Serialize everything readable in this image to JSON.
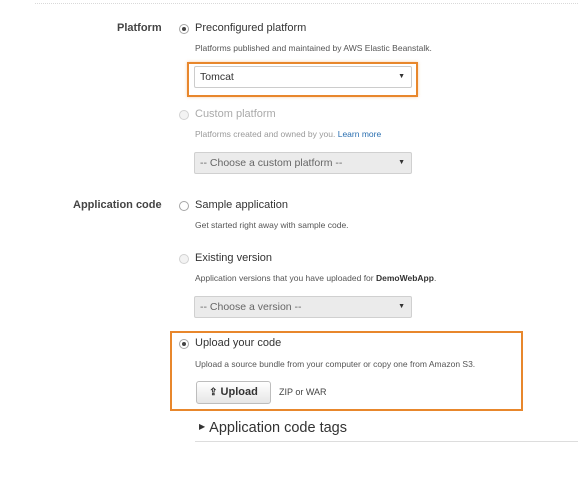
{
  "platform": {
    "label": "Platform",
    "preconfigured": {
      "title": "Preconfigured platform",
      "description": "Platforms published and maintained by AWS Elastic Beanstalk.",
      "selected": true,
      "select_value": "Tomcat"
    },
    "custom": {
      "title": "Custom platform",
      "description": "Platforms created and owned by you.",
      "link": "Learn more",
      "select_value": "-- Choose a custom platform --",
      "enabled": false
    }
  },
  "application_code": {
    "label": "Application code",
    "sample": {
      "title": "Sample application",
      "description": "Get started right away with sample code."
    },
    "existing": {
      "title": "Existing version",
      "description_prefix": "Application versions that you have uploaded for",
      "app_name": "DemoWebApp",
      "description_suffix": ".",
      "select_value": "-- Choose a version --",
      "enabled": false
    },
    "upload": {
      "title": "Upload your code",
      "description": "Upload a source bundle from your computer or copy one from Amazon S3.",
      "selected": true,
      "button_label": "Upload",
      "hint": "ZIP or WAR"
    }
  },
  "tags": {
    "label": "Application code tags"
  },
  "colors": {
    "highlight": "#e8872c",
    "link": "#2a6fb0"
  },
  "icons": {
    "radio": "radio-button",
    "select_caret": "caret-down-icon",
    "upload": "upload-icon",
    "expander": "caret-right-icon"
  }
}
